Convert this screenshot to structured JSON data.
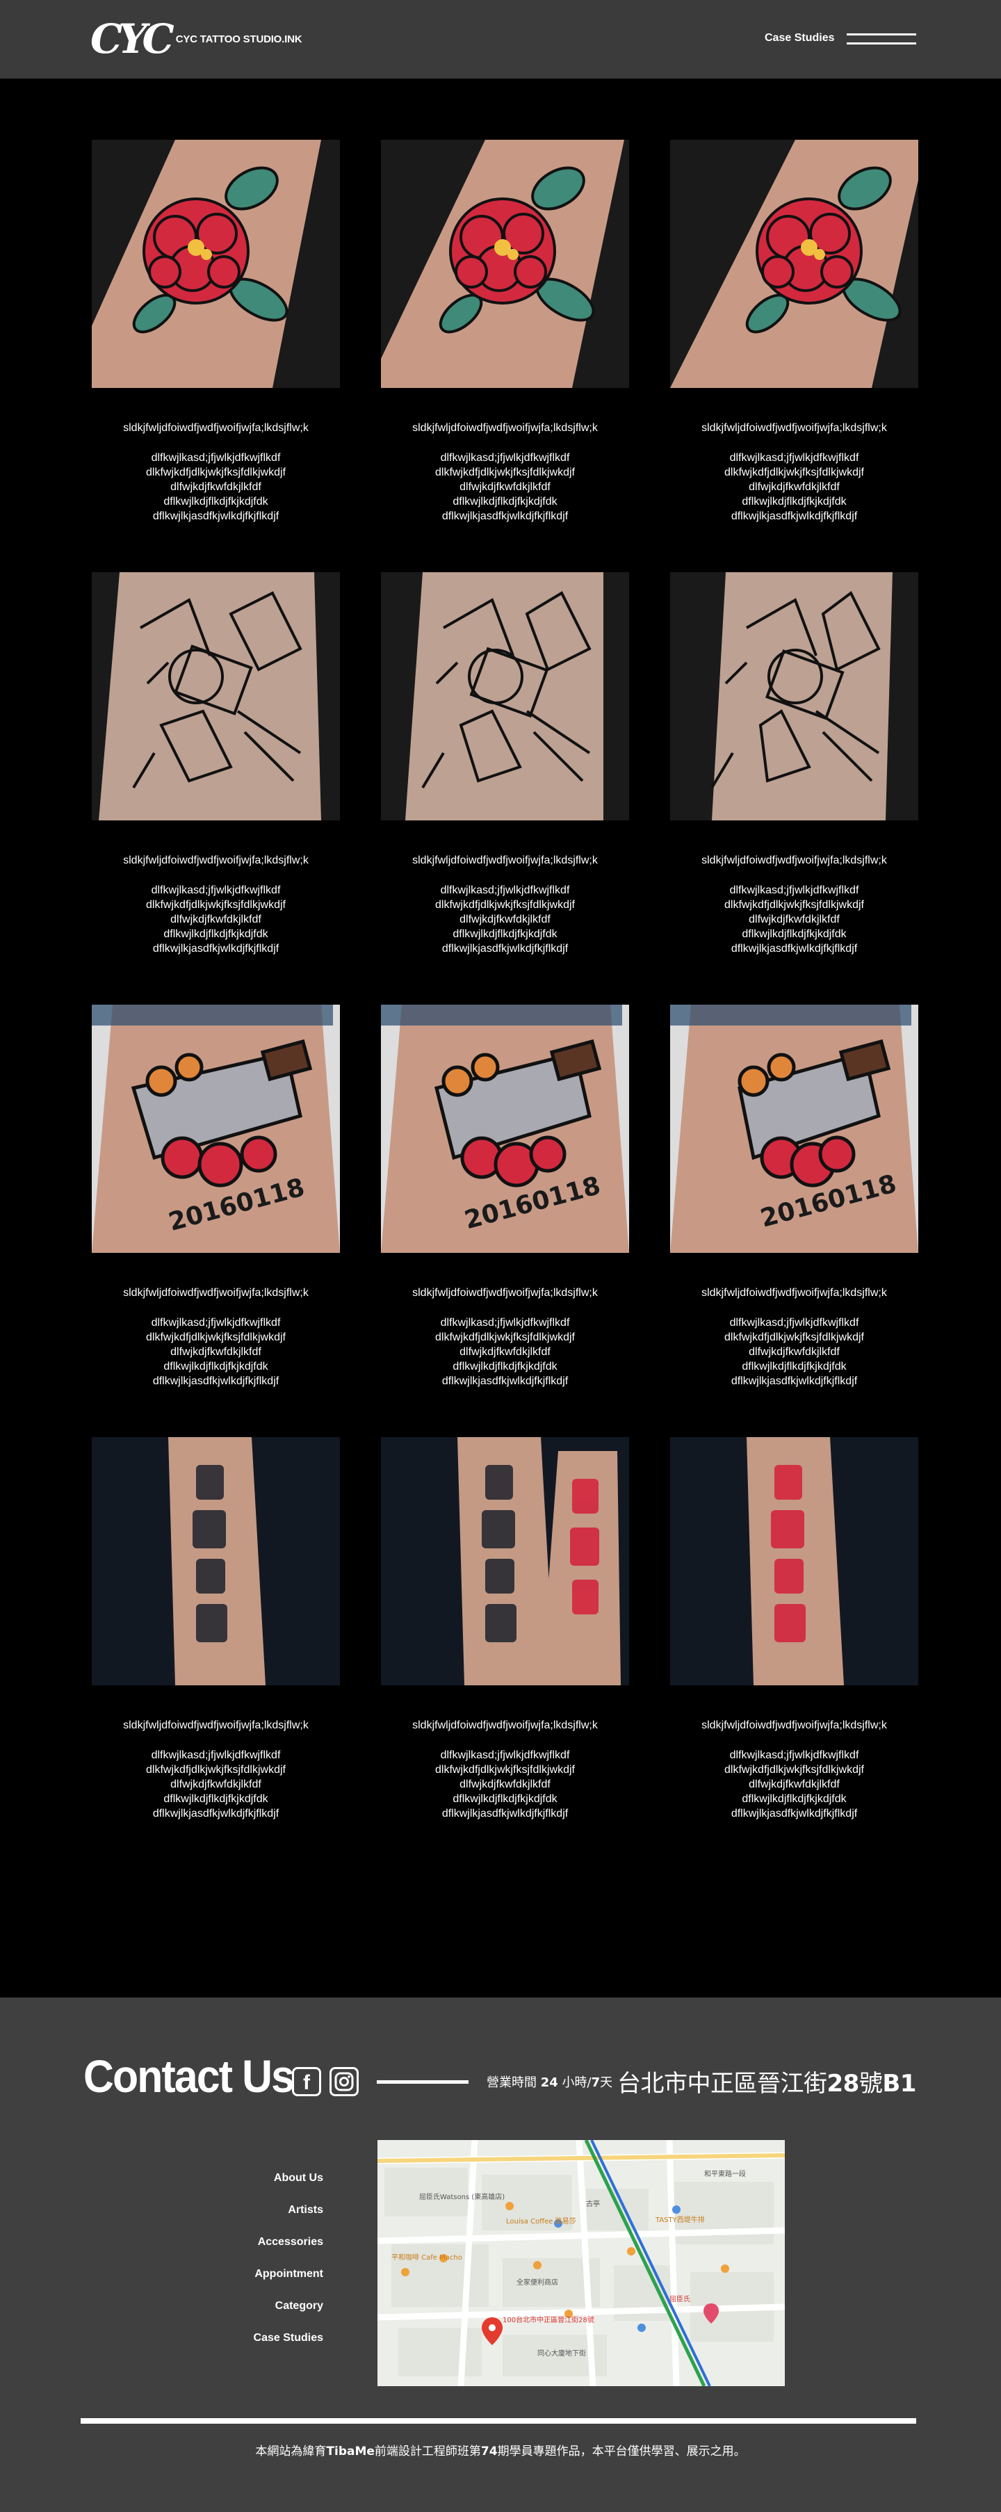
{
  "header": {
    "logo_mark": "CYC",
    "logo_text": "CYC TATTOO STUDIO.INK",
    "nav_link": "Case Studies"
  },
  "cards": [
    {
      "title": "sldkjfwljdfoiwdfjwdfjwoifjwjfa;lkdsjflw;k",
      "body": "dlfkwjlkasd;jfjwlkjdfkwjflkdf\ndlkfwjkdfjdlkjwkjfksjfdlkjwkdjf\ndlfwjkdjfkwfdkjlkfdf\ndflkwjlkdjflkdjfkjkdjfdk\ndflkwjlkjasdfkjwlkdjfkjflkdjf",
      "tattoo": "peony"
    },
    {
      "title": "sldkjfwljdfoiwdfjwdfjwoifjwjfa;lkdsjflw;k",
      "body": "dlfkwjlkasd;jfjwlkjdfkwjflkdf\ndlkfwjkdfjdlkjwkjfksjfdlkjwkdjf\ndlfwjkdjfkwfdkjlkfdf\ndflkwjlkdjflkdjfkjkdjfdk\ndflkwjlkjasdfkjwlkdjfkjflkdjf",
      "tattoo": "peony"
    },
    {
      "title": "sldkjfwljdfoiwdfjwdfjwoifjwjfa;lkdsjflw;k",
      "body": "dlfkwjlkasd;jfjwlkjdfkwjflkdf\ndlkfwjkdfjdlkjwkjfksjfdlkjwkdjf\ndlfwjkdjfkwfdkjlkfdf\ndflkwjlkdjflkdjfkjkdjfdk\ndflkwjlkjasdfkjwlkdjfkjflkdjf",
      "tattoo": "peony"
    },
    {
      "title": "sldkjfwljdfoiwdfjwdfjwoifjwjfa;lkdsjflw;k",
      "body": "dlfkwjlkasd;jfjwlkjdfkwjflkdf\ndlkfwjkdfjdlkjwkjfksjfdlkjwkdjf\ndlfwjkdjfkwfdkjlkfdf\ndflkwjlkdjflkdjfkjkdjfdk\ndflkwjlkjasdfkjwlkdjfkjflkdjf",
      "tattoo": "line"
    },
    {
      "title": "sldkjfwljdfoiwdfjwdfjwoifjwjfa;lkdsjflw;k",
      "body": "dlfkwjlkasd;jfjwlkjdfkwjflkdf\ndlkfwjkdfjdlkjwkjfksjfdlkjwkdjf\ndlfwjkdjfkwfdkjlkfdf\ndflkwjlkdjflkdjfkjkdjfdk\ndflkwjlkjasdfkjwlkdjfkjflkdjf",
      "tattoo": "line"
    },
    {
      "title": "sldkjfwljdfoiwdfjwdfjwoifjwjfa;lkdsjflw;k",
      "body": "dlfkwjlkasd;jfjwlkjdfkwjflkdf\ndlkfwjkdfjdlkjwkjfksjfdlkjwkdjf\ndlfwjkdjfkwfdkjlkfdf\ndflkwjlkdjflkdjfkjkdjfdk\ndflkwjlkjasdfkjwlkdjfkjflkdjf",
      "tattoo": "line"
    },
    {
      "title": "sldkjfwljdfoiwdfjwdfjwoifjwjfa;lkdsjflw;k",
      "body": "dlfkwjlkasd;jfjwlkjdfkwjflkdf\ndlkfwjkdfjdlkjwkjfksjfdlkjwkdjf\ndlfwjkdjfkwfdkjlkfdf\ndflkwjlkdjflkdjfkjkdjfdk\ndflkwjlkjasdfkjwlkdjfkjflkdjf",
      "tattoo": "cleaver"
    },
    {
      "title": "sldkjfwljdfoiwdfjwdfjwoifjwjfa;lkdsjflw;k",
      "body": "dlfkwjlkasd;jfjwlkjdfkwjflkdf\ndlkfwjkdfjdlkjwkjfksjfdlkjwkdjf\ndlfwjkdjfkwfdkjlkfdf\ndflkwjlkdjflkdjfkjkdjfdk\ndflkwjlkjasdfkjwlkdjfkjflkdjf",
      "tattoo": "cleaver"
    },
    {
      "title": "sldkjfwljdfoiwdfjwdfjwoifjwjfa;lkdsjflw;k",
      "body": "dlfkwjlkasd;jfjwlkjdfkwjflkdf\ndlkfwjkdfjdlkjwkjfksjfdlkjwkdjf\ndlfwjkdjfkwfdkjlkfdf\ndflkwjlkdjflkdjfkjkdjfdk\ndflkwjlkjasdfkjwlkdjfkjflkdjf",
      "tattoo": "cleaver"
    },
    {
      "title": "sldkjfwljdfoiwdfjwdfjwoifjwjfa;lkdsjflw;k",
      "body": "dlfkwjlkasd;jfjwlkjdfkwjflkdf\ndlkfwjkdfjdlkjwkjfksjfdlkjwkdjf\ndlfwjkdjfkwfdkjlkfdf\ndflkwjlkdjflkdjfkjkdjfdk\ndflkwjlkjasdfkjwlkdjfkjflkdjf",
      "tattoo": "script"
    },
    {
      "title": "sldkjfwljdfoiwdfjwdfjwoifjwjfa;lkdsjflw;k",
      "body": "dlfkwjlkasd;jfjwlkjdfkwjflkdf\ndlkfwjkdfjdlkjwkjfksjfdlkjwkdjf\ndlfwjkdjfkwfdkjlkfdf\ndflkwjlkdjflkdjfkjkdjfdk\ndflkwjlkjasdfkjwlkdjfkjflkdjf",
      "tattoo": "script"
    },
    {
      "title": "sldkjfwljdfoiwdfjwdfjwoifjwjfa;lkdsjflw;k",
      "body": "dlfkwjlkasd;jfjwlkjdfkwjflkdf\ndlkfwjkdfjdlkjwkjfksjfdlkjwkdjf\ndlfwjkdjfkwfdkjlkfdf\ndflkwjlkdjflkdjfkjkdjfdk\ndflkwjlkjasdfkjwlkdjfkjflkdjf",
      "tattoo": "script"
    }
  ],
  "footer": {
    "contact_title": "Contact Us",
    "facebook_glyph": "f",
    "hours_prefix": "營業時間",
    "hours_value": "24",
    "hours_unit": "小時/",
    "days_value": "7",
    "days_unit": "天",
    "address_prefix": "台北市中正區晉江街",
    "address_number": "28",
    "address_mid": "號",
    "address_floor": "B1",
    "nav": [
      "About Us",
      "Artists",
      "Accessories",
      "Appointment",
      "Category",
      "Case Studies"
    ],
    "map_labels": [
      "屈臣氏Watsons (東高雄店)",
      "和平東路一段",
      "Louisa Coffee 路易莎",
      "平和咖啡 Cafe Macho",
      "TASTY西堤牛排",
      "全家便利商店",
      "100台北市中正區晉江街28號",
      "同心大廈地下街",
      "古亭",
      "屈臣氏"
    ],
    "copyright_a": "本網站為緯育",
    "copyright_brand": "TibaMe",
    "copyright_b": "前端設計工程師班第",
    "copyright_num": "74",
    "copyright_c": "期學員專題作品，本平台僅供學習、展示之用。"
  },
  "colors": {
    "header_bg": "#3b3b3b",
    "page_bg": "#000000",
    "footer_bg": "#404040",
    "tattoo_red": "#d2293f",
    "tattoo_teal": "#3f8a78",
    "skin": "#c89a86",
    "map_pin": "#e33b2e"
  }
}
